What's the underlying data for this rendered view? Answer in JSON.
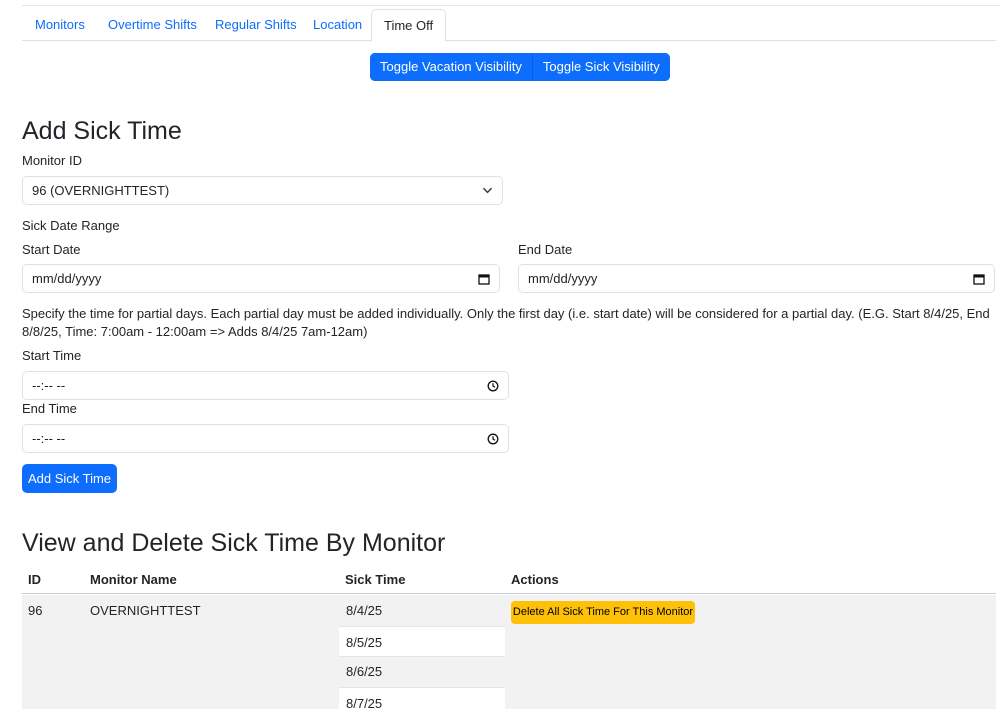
{
  "tabs": [
    {
      "label": "Monitors"
    },
    {
      "label": "Overtime Shifts"
    },
    {
      "label": "Regular Shifts"
    },
    {
      "label": "Location"
    },
    {
      "label": "Time Off",
      "active": true
    }
  ],
  "toggles": {
    "vacation_label": "Toggle Vacation Visibility",
    "sick_label": "Toggle Sick Visibility"
  },
  "add_sick": {
    "heading": "Add Sick Time",
    "monitor_label": "Monitor ID",
    "monitor_value": "96 (OVERNIGHTTEST)",
    "range_label": "Sick Date Range",
    "start_date_label": "Start Date",
    "start_date_placeholder": "mm/dd/yyyy",
    "end_date_label": "End Date",
    "end_date_placeholder": "mm/dd/yyyy",
    "help_text": "Specify the time for partial days. Each partial day must be added individually. Only the first day (i.e. start date) will be considered for a partial day. (E.G. Start 8/4/25, End 8/8/25, Time: 7:00am - 12:00am => Adds 8/4/25 7am-12am)",
    "start_time_label": "Start Time",
    "start_time_placeholder": "--:-- --",
    "end_time_label": "End Time",
    "end_time_placeholder": "--:-- --",
    "submit_label": "Add Sick Time"
  },
  "view_sick": {
    "heading": "View and Delete Sick Time By Monitor",
    "columns": [
      "ID",
      "Monitor Name",
      "Sick Time",
      "Actions"
    ],
    "rows": [
      {
        "id": "96",
        "name": "OVERNIGHTTEST",
        "dates": [
          "8/4/25",
          "8/5/25",
          "8/6/25",
          "8/7/25"
        ],
        "action_label": "Delete All Sick Time For This Monitor"
      }
    ]
  },
  "colors": {
    "primary": "#0d6efd",
    "warning": "#ffc107",
    "row_bg": "#f2f2f2"
  }
}
